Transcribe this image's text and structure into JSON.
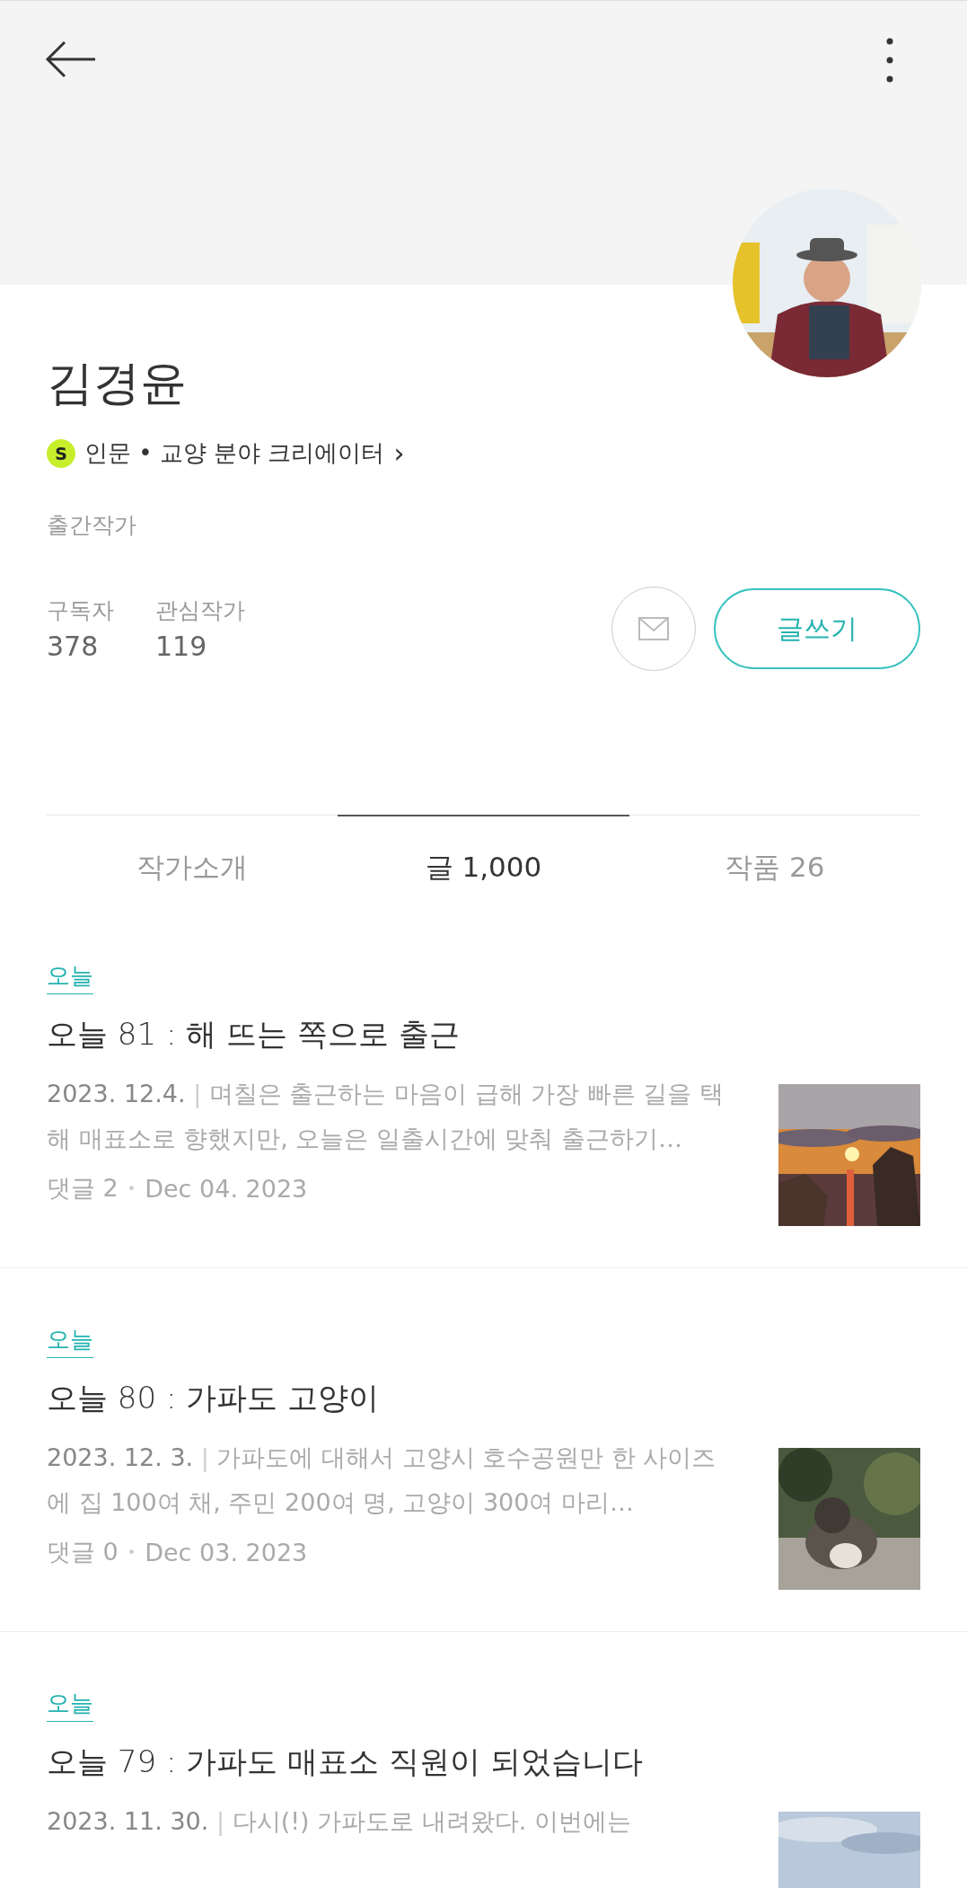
{
  "profile": {
    "name": "김경윤",
    "badge": "S",
    "category": "인문 • 교양 분야 크리에이터",
    "category_arrow": "›",
    "role": "출간작가",
    "stats": [
      {
        "label": "구독자",
        "value": "378"
      },
      {
        "label": "관심작가",
        "value": "119"
      }
    ],
    "write_button": "글쓰기"
  },
  "tabs": [
    {
      "label": "작가소개",
      "selected": false
    },
    {
      "label": "글 1,000",
      "selected": true
    },
    {
      "label": "작품 26",
      "selected": false
    }
  ],
  "articles": [
    {
      "magazine": "오늘",
      "title": "오늘 81 : 해 뜨는 쪽으로 출근",
      "date": "2023. 12.4.",
      "separator": "|",
      "excerpt": "며칠은 출근하는 마음이 급해 가장 빠른 길을 택해 매표소로 향했지만, 오늘은 일출시간에 맞춰 출근하기…",
      "comments": "댓글 2",
      "meta_separator": "•",
      "published": "Dec 04. 2023"
    },
    {
      "magazine": "오늘",
      "title": "오늘 80 : 가파도 고양이",
      "date": "2023. 12. 3.",
      "separator": "|",
      "excerpt": "가파도에 대해서 고양시 호수공원만 한 사이즈에 집 100여 채, 주민 200여 명, 고양이 300여 마리…",
      "comments": "댓글 0",
      "meta_separator": "•",
      "published": "Dec 03. 2023"
    },
    {
      "magazine": "오늘",
      "title": "오늘 79 : 가파도 매표소 직원이 되었습니다",
      "date": "2023. 11. 30.",
      "separator": "|",
      "excerpt": "다시(!) 가파도로 내려왔다. 이번에는"
    }
  ]
}
